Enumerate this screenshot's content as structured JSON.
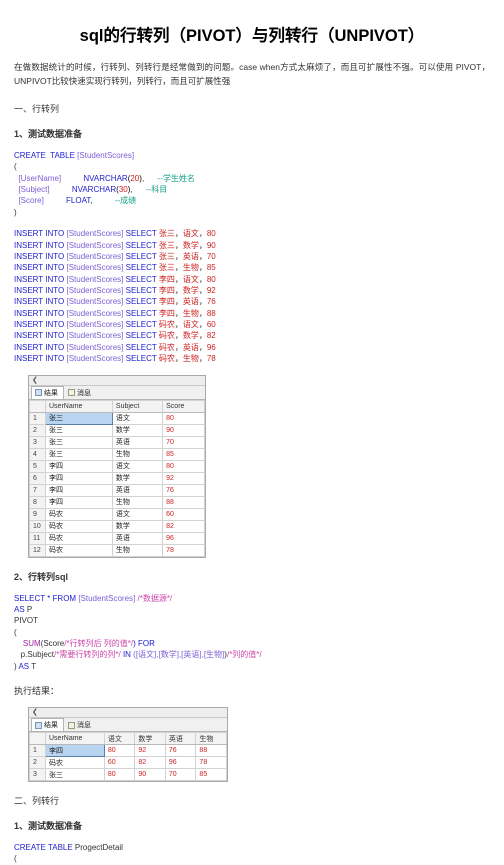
{
  "page": {
    "title": "sql的行转列（PIVOT）与列转行（UNPIVOT）",
    "intro": "在做数据统计的时候，行转列、列转行是经常做到的问题。case when方式太麻烦了，而且可扩展性不强。可以使用 PIVOT，UNPIVOT比较快速实现行转列，列转行，而且可扩展性强"
  },
  "sections": {
    "s1_heading": "一、行转列",
    "s1_sub1": "1、测试数据准备",
    "s1_sub2": "2、行转列sql",
    "exec_result_label": "执行结果：",
    "s2_heading": "二、列转行",
    "s2_sub1": "1、测试数据准备"
  },
  "code": {
    "create_table": {
      "kw_create": "CREATE",
      "kw_table": "TABLE",
      "table_name": "[StudentScores]",
      "open_paren": "(",
      "close_paren": ")",
      "columns": [
        {
          "name": "[UserName]",
          "type": "NVARCHAR",
          "size": "20",
          "tail": ",",
          "comment": "--学生姓名"
        },
        {
          "name": "[Subject]",
          "type": "NVARCHAR",
          "size": "30",
          "tail": ",",
          "comment": "--科目"
        },
        {
          "name": "[Score]",
          "type": "FLOAT",
          "size": "",
          "tail": ",",
          "comment": "--成绩"
        }
      ]
    },
    "inserts": {
      "prefix_kw": "INSERT INTO",
      "table": "[StudentScores]",
      "select_kw": "SELECT",
      "rows": [
        {
          "name": "张三",
          "subject": "语文",
          "score": "80"
        },
        {
          "name": "张三",
          "subject": "数学",
          "score": "90"
        },
        {
          "name": "张三",
          "subject": "英语",
          "score": "70"
        },
        {
          "name": "张三",
          "subject": "生物",
          "score": "85"
        },
        {
          "name": "李四",
          "subject": "语文",
          "score": "80"
        },
        {
          "name": "李四",
          "subject": "数学",
          "score": "92"
        },
        {
          "name": "李四",
          "subject": "英语",
          "score": "76"
        },
        {
          "name": "李四",
          "subject": "生物",
          "score": "88"
        },
        {
          "name": "码农",
          "subject": "语文",
          "score": "60"
        },
        {
          "name": "码农",
          "subject": "数学",
          "score": "82"
        },
        {
          "name": "码农",
          "subject": "英语",
          "score": "96"
        },
        {
          "name": "码农",
          "subject": "生物",
          "score": "78"
        }
      ]
    },
    "pivot_sql": {
      "line1_kw": "SELECT * FROM",
      "line1_table": "[StudentScores]",
      "line1_comment": "/*数据源*/",
      "line2_kw": "AS",
      "line2_alias": "P",
      "line3": "PIVOT",
      "line4": "(",
      "line5_fn": "SUM",
      "line5_arg": "(Score",
      "line5_comment": "/*行转列后 列的值*/",
      "line5_for": ") FOR",
      "line6_col": "p.Subject",
      "line6_comment": "/*需要行转列的列*/",
      "line6_in": "IN",
      "line6_list": "([语文],[数学],[英语],[生物]",
      "line6_comment2": "/*列的值*/",
      "line6_close": ")",
      "line7_close": ")",
      "line7_kw": "AS",
      "line7_alias": "T"
    },
    "create_table2": {
      "kw_create": "CREATE",
      "kw_table": "TABLE",
      "table_name": "ProgectDetail",
      "open_paren": "("
    }
  },
  "grid1": {
    "tab_results": "结果",
    "tab_messages": "消息",
    "columns": [
      "",
      "UserName",
      "Subject",
      "Score"
    ],
    "rows": [
      {
        "n": "1",
        "UserName": "张三",
        "Subject": "语文",
        "Score": "80"
      },
      {
        "n": "2",
        "UserName": "张三",
        "Subject": "数学",
        "Score": "90"
      },
      {
        "n": "3",
        "UserName": "张三",
        "Subject": "英语",
        "Score": "70"
      },
      {
        "n": "4",
        "UserName": "张三",
        "Subject": "生物",
        "Score": "85"
      },
      {
        "n": "5",
        "UserName": "李四",
        "Subject": "语文",
        "Score": "80"
      },
      {
        "n": "6",
        "UserName": "李四",
        "Subject": "数学",
        "Score": "92"
      },
      {
        "n": "7",
        "UserName": "李四",
        "Subject": "英语",
        "Score": "76"
      },
      {
        "n": "8",
        "UserName": "李四",
        "Subject": "生物",
        "Score": "88"
      },
      {
        "n": "9",
        "UserName": "码农",
        "Subject": "语文",
        "Score": "60"
      },
      {
        "n": "10",
        "UserName": "码农",
        "Subject": "数学",
        "Score": "82"
      },
      {
        "n": "11",
        "UserName": "码农",
        "Subject": "英语",
        "Score": "96"
      },
      {
        "n": "12",
        "UserName": "码农",
        "Subject": "生物",
        "Score": "78"
      }
    ]
  },
  "grid2": {
    "tab_results": "结果",
    "tab_messages": "消息",
    "columns": [
      "",
      "UserName",
      "语文",
      "数学",
      "英语",
      "生物"
    ],
    "rows": [
      {
        "n": "1",
        "UserName": "李四",
        "c1": "80",
        "c2": "92",
        "c3": "76",
        "c4": "88"
      },
      {
        "n": "2",
        "UserName": "码农",
        "c1": "60",
        "c2": "82",
        "c3": "96",
        "c4": "78"
      },
      {
        "n": "3",
        "UserName": "张三",
        "c1": "80",
        "c2": "90",
        "c3": "70",
        "c4": "85"
      }
    ]
  }
}
